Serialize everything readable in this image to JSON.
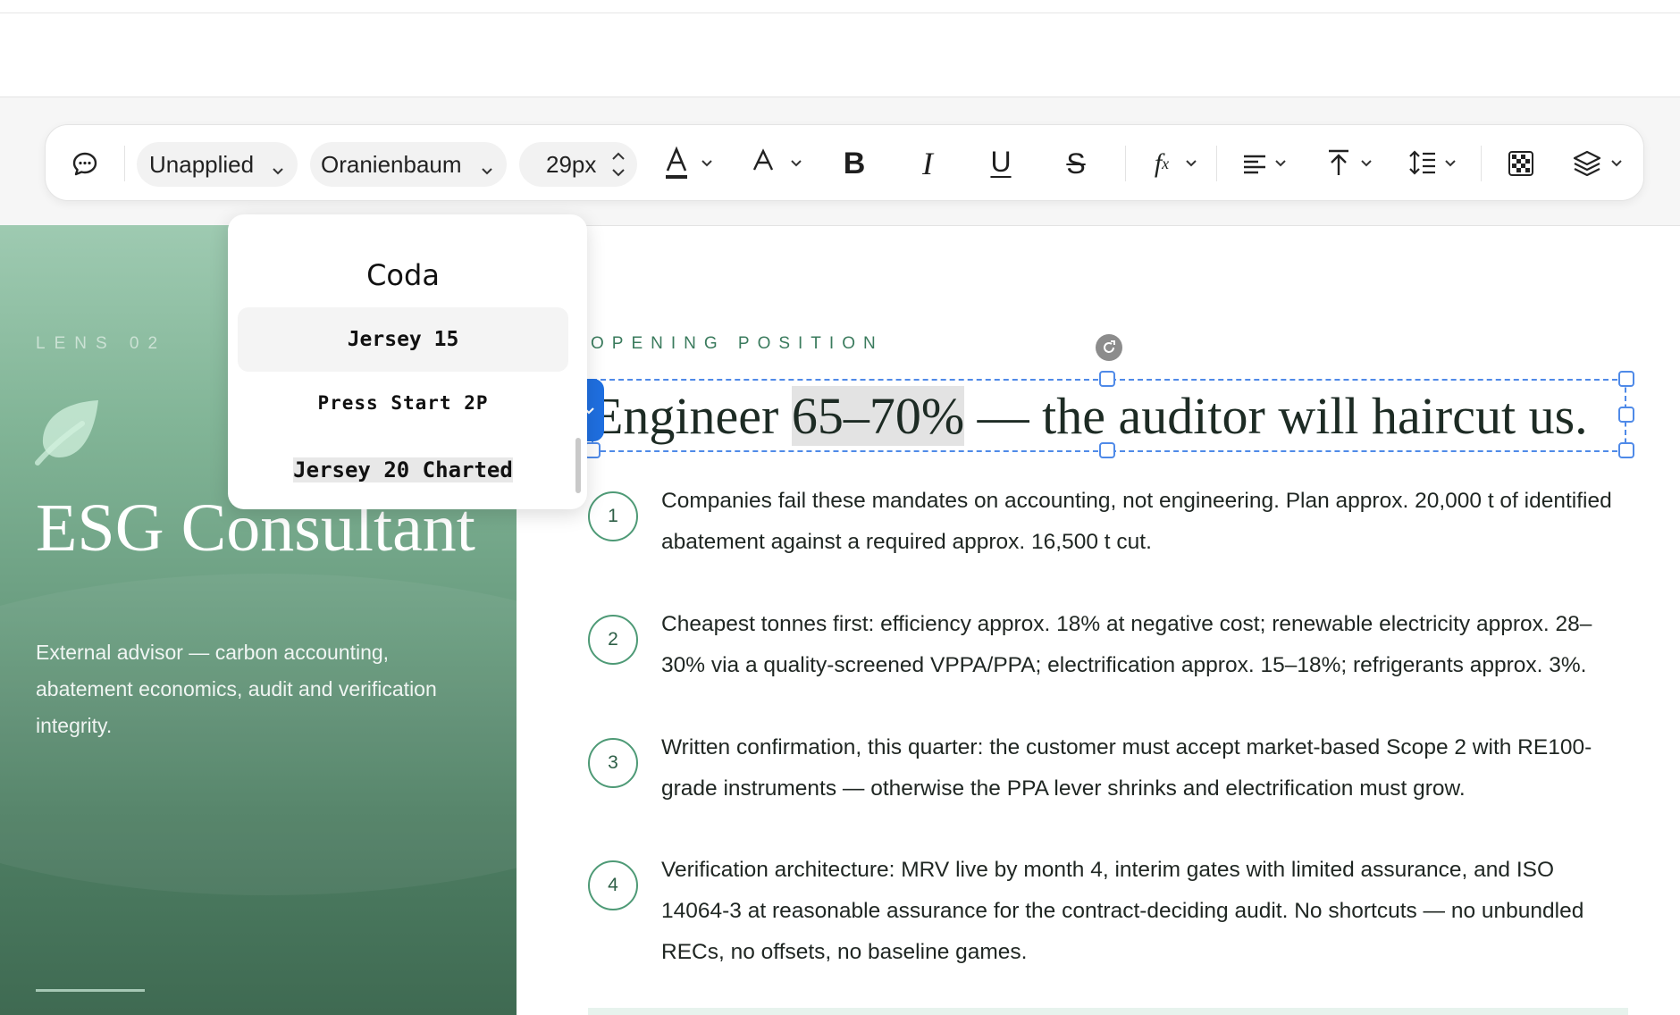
{
  "toolbar": {
    "comment_icon": "comment-icon",
    "style_select": "Unapplied",
    "font_select": "Oranienbaum",
    "font_size": "29px",
    "icons": [
      "text-color-icon",
      "text-size-icon",
      "bold-icon",
      "italic-icon",
      "underline-icon",
      "strikethrough-icon",
      "formula-icon",
      "align-left-icon",
      "vertical-align-top-icon",
      "line-height-icon",
      "checkerboard-icon",
      "layers-icon"
    ]
  },
  "font_dropdown": {
    "items": [
      "Coda",
      "Jersey 15",
      "Press Start 2P",
      "Jersey 20 Charted"
    ],
    "highlighted": "Jersey 15"
  },
  "hero": {
    "lens": "LENS 02",
    "title": "ESG Consultant",
    "description": "External advisor — carbon accounting, abatement economics, audit and verification integrity.",
    "icon": "leaf-icon"
  },
  "content": {
    "kicker": "OPENING POSITION",
    "headline_prefix": "Engineer ",
    "headline_selected": "65–70%",
    "headline_suffix": " — the auditor will haircut us.",
    "points": [
      {
        "n": "1",
        "text": "Companies fail these mandates on accounting, not engineering. Plan approx. 20,000 t of identified abatement against a required approx. 16,500 t cut."
      },
      {
        "n": "2",
        "text": "Cheapest tonnes first: efficiency approx. 18% at negative cost; renewable electricity approx. 28–30% via a quality-screened VPPA/PPA; electrification approx. 15–18%; refrigerants approx. 3%."
      },
      {
        "n": "3",
        "text": "Written confirmation, this quarter: the customer must accept market-based Scope 2 with RE100-grade instruments — otherwise the PPA lever shrinks and electrification must grow."
      },
      {
        "n": "4",
        "text": "Verification architecture: MRV live by month 4, interim gates with limited assurance, and ISO 14064-3 at reasonable assurance for the contract-deciding audit. No shortcuts — no unbundled RECs, no offsets, no baseline games."
      }
    ]
  },
  "colors": {
    "accent_blue": "#1f6fe0",
    "selection_border": "#4f8ae8",
    "green_accent": "#3a7b5d",
    "hero_top": "#9ecab1",
    "hero_bottom": "#3f6a52"
  }
}
